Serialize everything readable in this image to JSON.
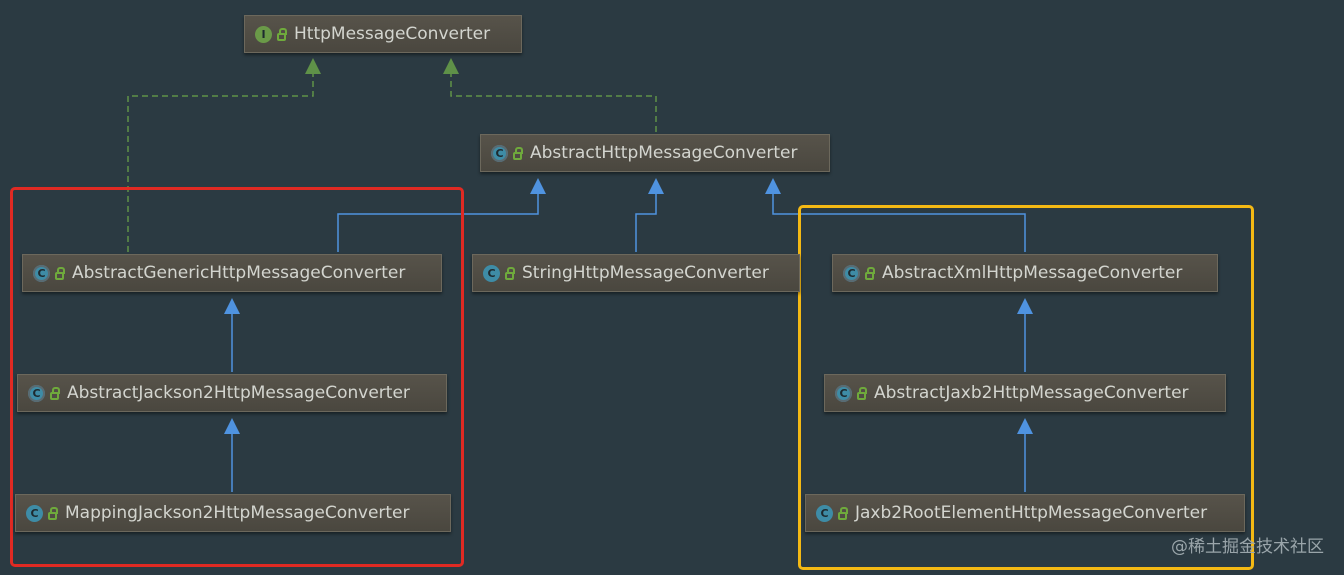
{
  "diagram": {
    "nodes": {
      "http_message_converter": {
        "name": "HttpMessageConverter",
        "kind": "interface",
        "badge": "I"
      },
      "abstract_http_message_converter": {
        "name": "AbstractHttpMessageConverter",
        "kind": "abstract",
        "badge": "C"
      },
      "abstract_generic_http_message_converter": {
        "name": "AbstractGenericHttpMessageConverter",
        "kind": "abstract",
        "badge": "C"
      },
      "string_http_message_converter": {
        "name": "StringHttpMessageConverter",
        "kind": "class",
        "badge": "C"
      },
      "abstract_xml_http_message_converter": {
        "name": "AbstractXmlHttpMessageConverter",
        "kind": "abstract",
        "badge": "C"
      },
      "abstract_jackson2_http_message_converter": {
        "name": "AbstractJackson2HttpMessageConverter",
        "kind": "abstract",
        "badge": "C"
      },
      "abstract_jaxb2_http_message_converter": {
        "name": "AbstractJaxb2HttpMessageConverter",
        "kind": "abstract",
        "badge": "C"
      },
      "mapping_jackson2_http_message_converter": {
        "name": "MappingJackson2HttpMessageConverter",
        "kind": "class",
        "badge": "C"
      },
      "jaxb2_root_element_http_message_converter": {
        "name": "Jaxb2RootElementHttpMessageConverter",
        "kind": "class",
        "badge": "C"
      }
    },
    "edges": [
      {
        "from": "abstract_generic_http_message_converter",
        "to": "http_message_converter",
        "type": "implements"
      },
      {
        "from": "abstract_http_message_converter",
        "to": "http_message_converter",
        "type": "implements"
      },
      {
        "from": "abstract_generic_http_message_converter",
        "to": "abstract_http_message_converter",
        "type": "extends"
      },
      {
        "from": "string_http_message_converter",
        "to": "abstract_http_message_converter",
        "type": "extends"
      },
      {
        "from": "abstract_xml_http_message_converter",
        "to": "abstract_http_message_converter",
        "type": "extends"
      },
      {
        "from": "abstract_jackson2_http_message_converter",
        "to": "abstract_generic_http_message_converter",
        "type": "extends"
      },
      {
        "from": "mapping_jackson2_http_message_converter",
        "to": "abstract_jackson2_http_message_converter",
        "type": "extends"
      },
      {
        "from": "abstract_jaxb2_http_message_converter",
        "to": "abstract_xml_http_message_converter",
        "type": "extends"
      },
      {
        "from": "jaxb2_root_element_http_message_converter",
        "to": "abstract_jaxb2_http_message_converter",
        "type": "extends"
      }
    ],
    "highlight_colors": {
      "jackson_group": "#e02a23",
      "xml_group": "#f4b914"
    },
    "edge_colors": {
      "implements": "#5f9148",
      "extends": "#4f93e0"
    }
  },
  "watermark": "@稀土掘金技术社区"
}
